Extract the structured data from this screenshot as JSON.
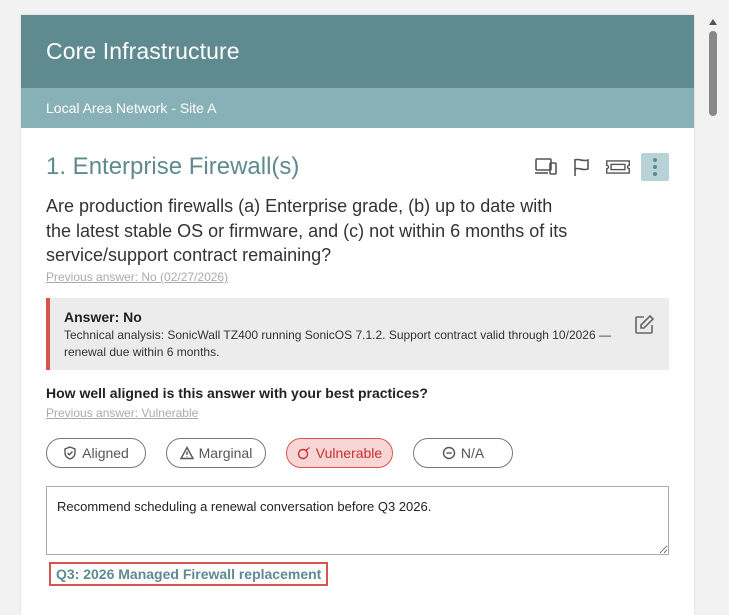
{
  "header": {
    "title": "Core Infrastructure"
  },
  "subheader": {
    "title": "Local Area Network - Site A"
  },
  "question": {
    "title": "1. Enterprise Firewall(s)",
    "text": "Are production firewalls (a) Enterprise grade, (b) up to date with the latest stable OS or firmware, and (c) not within 6 months of its service/support contract remaining?",
    "previous_answer": "Previous answer: No (02/27/2026)"
  },
  "toolbar": {
    "icons": [
      "devices-icon",
      "flag-icon",
      "ticket-icon",
      "more-vertical-icon"
    ]
  },
  "answer": {
    "label": "Answer: No",
    "analysis": "Technical analysis: SonicWall TZ400 running SonicOS 7.1.2. Support contract valid through 10/2026 — renewal due within 6 months."
  },
  "alignment": {
    "question": "How well aligned is this answer with your best practices?",
    "previous_answer": "Previous answer: Vulnerable",
    "options": [
      {
        "label": "Aligned",
        "icon": "shield-check-icon",
        "selected": false
      },
      {
        "label": "Marginal",
        "icon": "warning-icon",
        "selected": false
      },
      {
        "label": "Vulnerable",
        "icon": "bomb-icon",
        "selected": true
      },
      {
        "label": "N/A",
        "icon": "minus-circle-icon",
        "selected": false
      }
    ],
    "colors": {
      "selected_bg": "#f9d6d6",
      "selected_border": "#d9534f"
    }
  },
  "notes": {
    "value": "Recommend scheduling a renewal conversation before Q3 2026."
  },
  "roadmap_link": {
    "label": "Q3: 2026 Managed Firewall replacement"
  },
  "theme": {
    "header": "#5e8a90",
    "subheader": "#88b0b7",
    "alert": "#d9534f"
  }
}
